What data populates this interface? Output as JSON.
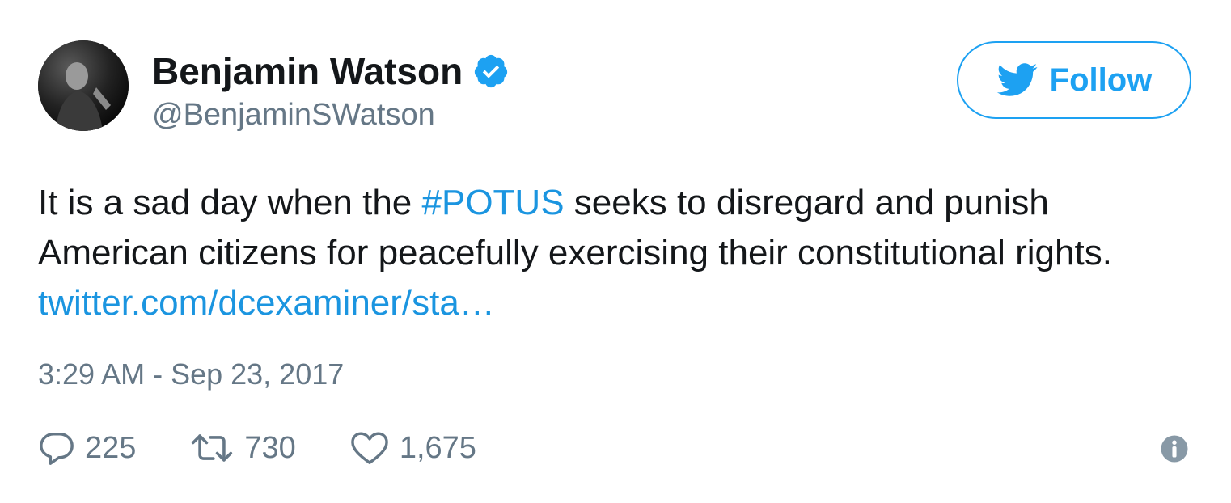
{
  "tweet": {
    "author": {
      "display_name": "Benjamin Watson",
      "handle": "@BenjaminSWatson",
      "verified": true
    },
    "follow_label": "Follow",
    "text": {
      "part1": "It is a sad day when the ",
      "hashtag": "#POTUS",
      "part2": " seeks to disregard and punish American citizens for peacefully exercising their constitutional rights. ",
      "link": "twitter.com/dcexaminer/sta…"
    },
    "timestamp": "3:29 AM - Sep 23, 2017",
    "stats": {
      "replies": "225",
      "retweets": "730",
      "likes": "1,675"
    }
  },
  "icons": {
    "verified": "verified-badge-icon",
    "follow": "twitter-bird-icon",
    "reply": "speech-bubble-icon",
    "retweet": "retweet-arrows-icon",
    "like": "heart-icon",
    "info": "info-icon"
  },
  "colors": {
    "brand": "#1da1f2",
    "link": "#1b95e0",
    "text": "#14171a",
    "secondary": "#657786"
  }
}
